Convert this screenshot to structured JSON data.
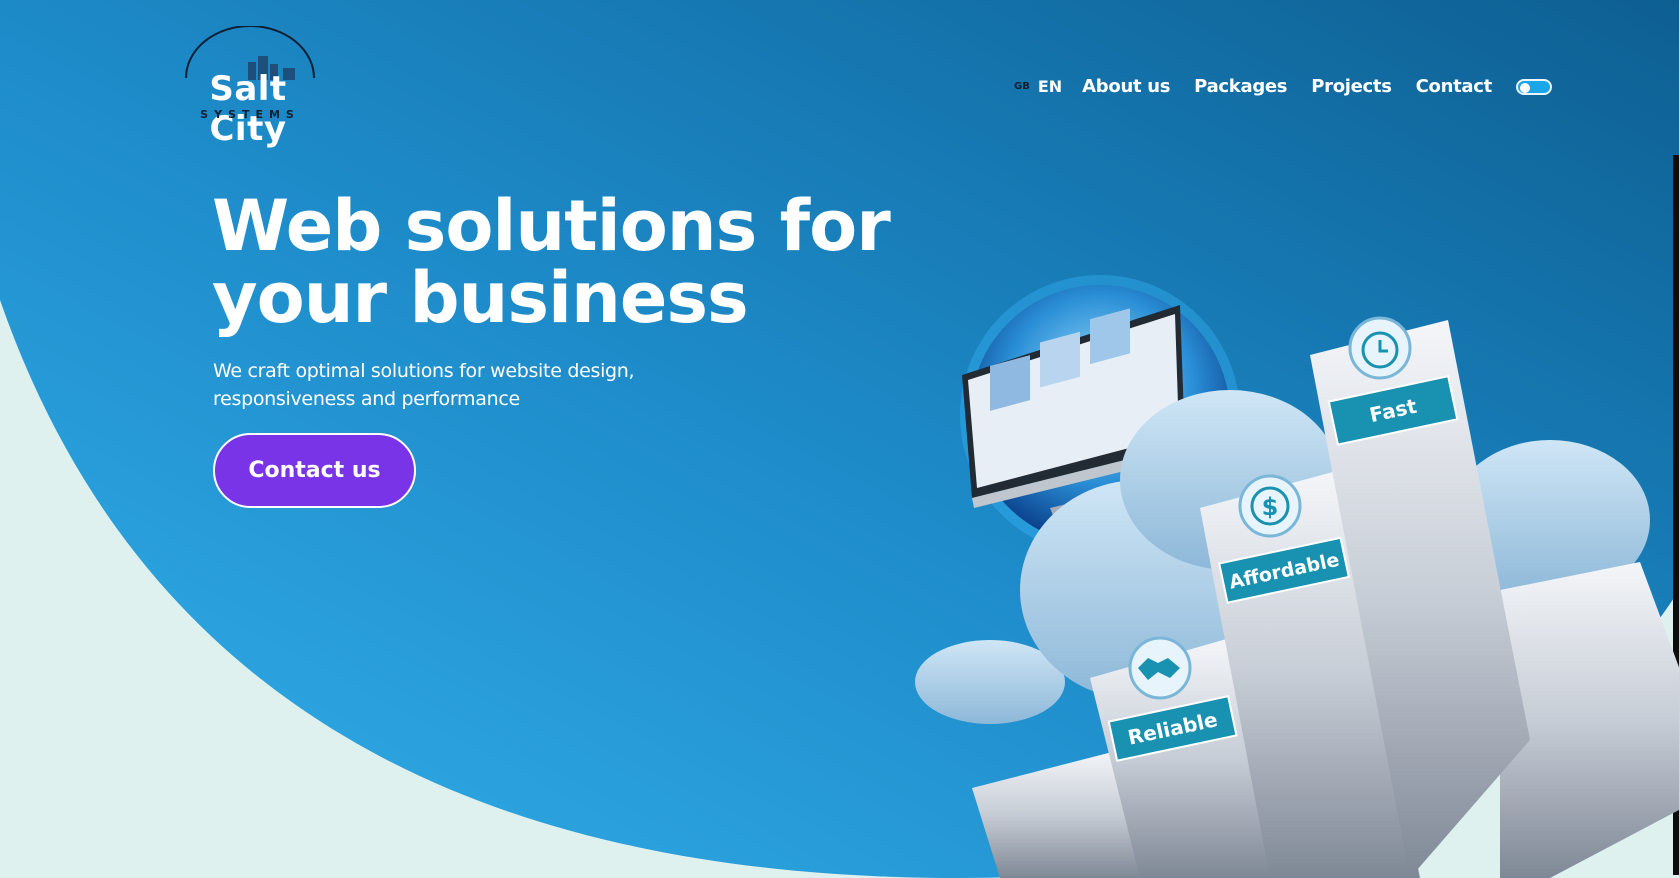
{
  "brand": {
    "name": "Salt City",
    "subtitle": "SYSTEMS"
  },
  "nav": {
    "lang_code": "GB",
    "lang_label": "EN",
    "links": [
      "About us",
      "Packages",
      "Projects",
      "Contact"
    ],
    "theme_toggle_on": false
  },
  "hero": {
    "headline_line1": "Web solutions for",
    "headline_line2": "your business",
    "subtext_line1": "We craft optimal solutions for website design,",
    "subtext_line2": "responsiveness and performance",
    "cta_label": "Contact us"
  },
  "illustration": {
    "pillars": [
      "Reliable",
      "Affordable",
      "Fast"
    ],
    "icons": [
      "handshake-icon",
      "dollar-icon",
      "clock-icon",
      "monitor-icon",
      "globe-icon",
      "cloud-icon"
    ]
  },
  "colors": {
    "hero_blue_dark": "#0f6ea3",
    "hero_blue_light": "#2aa6e4",
    "page_bg": "#dff1ef",
    "cta_purple": "#7a34e8",
    "label_teal": "#1991b0"
  }
}
